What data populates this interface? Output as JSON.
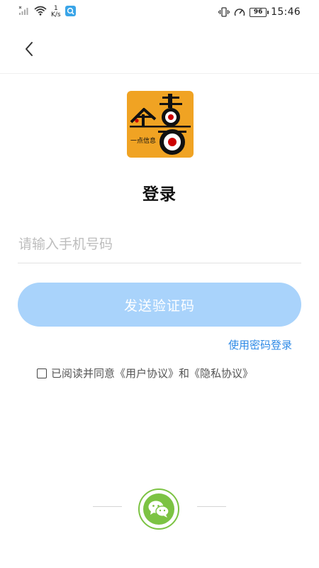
{
  "status_bar": {
    "speed_value": "1",
    "speed_unit": "K/s",
    "battery": "96",
    "time": "15:46"
  },
  "logo": {
    "text": "一点信息"
  },
  "page": {
    "title": "登录"
  },
  "form": {
    "phone_placeholder": "请输入手机号码",
    "send_code_label": "发送验证码",
    "password_login_label": "使用密码登录",
    "agreement_text": "已阅读并同意《用户协议》和《隐私协议》"
  },
  "colors": {
    "primary": "#a9d3fb",
    "link": "#2e8ae6",
    "logo_bg": "#f0a323",
    "wechat": "#7cc343"
  },
  "icons": {
    "back": "chevron-left-icon",
    "wechat": "wechat-icon"
  }
}
